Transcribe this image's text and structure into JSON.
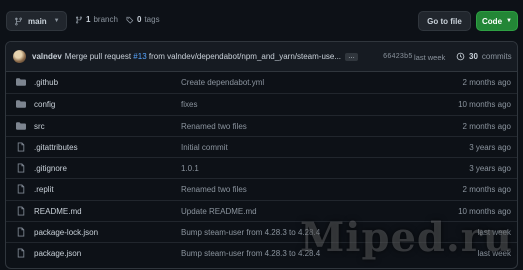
{
  "toolbar": {
    "branch_label": "main",
    "branches_count": "1",
    "branches_label": "branch",
    "tags_count": "0",
    "tags_label": "tags",
    "goto_file_label": "Go to file",
    "code_label": "Code"
  },
  "latest_commit": {
    "author": "valndev",
    "message_prefix": "Merge pull request",
    "pr_number": "#13",
    "message_suffix": "from valndev/dependabot/npm_and_yarn/steam-use...",
    "ellipsis": "…",
    "sha": "66423b5",
    "time": "last week",
    "commits_count": "30",
    "commits_label": "commits"
  },
  "files": [
    {
      "type": "folder",
      "name": ".github",
      "message": "Create dependabot.yml",
      "age": "2 months ago"
    },
    {
      "type": "folder",
      "name": "config",
      "message": "fixes",
      "age": "10 months ago"
    },
    {
      "type": "folder",
      "name": "src",
      "message": "Renamed two files",
      "age": "2 months ago"
    },
    {
      "type": "file",
      "name": ".gitattributes",
      "message": "Initial commit",
      "age": "3 years ago"
    },
    {
      "type": "file",
      "name": ".gitignore",
      "message": "1.0.1",
      "age": "3 years ago"
    },
    {
      "type": "file",
      "name": ".replit",
      "message": "Renamed two files",
      "age": "2 months ago"
    },
    {
      "type": "file",
      "name": "README.md",
      "message": "Update README.md",
      "age": "10 months ago"
    },
    {
      "type": "file",
      "name": "package-lock.json",
      "message": "Bump steam-user from 4.28.3 to 4.28.4",
      "age": "last week"
    },
    {
      "type": "file",
      "name": "package.json",
      "message": "Bump steam-user from 4.28.3 to 4.28.4",
      "age": "last week"
    }
  ],
  "watermark": {
    "text": "Miped.ru"
  },
  "colors": {
    "background": "#0d1117",
    "accent_green": "#238636",
    "link_blue": "#58a6ff",
    "folder_icon": "#7d8590",
    "muted_text": "#8b949e"
  }
}
